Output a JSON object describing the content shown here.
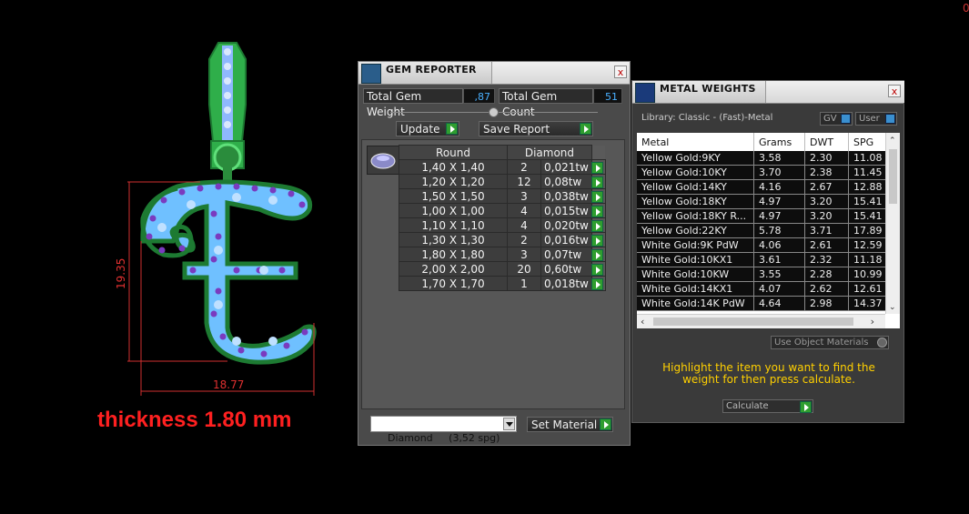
{
  "viewport": {
    "dimension_height": "19.35",
    "dimension_width": "18.77",
    "thickness_label": "thickness 1.80 mm",
    "corner_mark": "0"
  },
  "gem_reporter": {
    "title": "GEM REPORTER",
    "close": "x",
    "total_gem_weight_label": "Total Gem Weight",
    "total_gem_weight_value": ",87",
    "total_gem_count_label": "Total Gem Count",
    "total_gem_count_value": "51",
    "update_label": "Update",
    "save_report_label": "Save Report",
    "table_headers": [
      "Round",
      "Diamond"
    ],
    "rows": [
      {
        "size": "1,40 X 1,40",
        "count": "2",
        "weight": "0,021tw"
      },
      {
        "size": "1,20 X 1,20",
        "count": "12",
        "weight": "0,08tw"
      },
      {
        "size": "1,50 X 1,50",
        "count": "3",
        "weight": "0,038tw"
      },
      {
        "size": "1,00 X 1,00",
        "count": "4",
        "weight": "0,015tw"
      },
      {
        "size": "1,10 X 1,10",
        "count": "4",
        "weight": "0,020tw"
      },
      {
        "size": "1,30 X 1,30",
        "count": "2",
        "weight": "0,016tw"
      },
      {
        "size": "1,80 X 1,80",
        "count": "3",
        "weight": "0,07tw"
      },
      {
        "size": "2,00 X 2,00",
        "count": "20",
        "weight": "0,60tw"
      },
      {
        "size": "1,70 X 1,70",
        "count": "1",
        "weight": "0,018tw"
      }
    ],
    "material_select": "Diamond     (3,52 spg)",
    "set_material_label": "Set Material"
  },
  "metal_weights": {
    "title": "METAL WEIGHTS",
    "close": "x",
    "library_label": "Library: Classic - (Fast)-Metal",
    "gv_label": "GV",
    "user_label": "User",
    "columns": [
      "Metal",
      "Grams",
      "DWT",
      "SPG"
    ],
    "rows": [
      {
        "metal": "Yellow Gold:9KY",
        "grams": "3.58",
        "dwt": "2.30",
        "spg": "11.08"
      },
      {
        "metal": "Yellow Gold:10KY",
        "grams": "3.70",
        "dwt": "2.38",
        "spg": "11.45"
      },
      {
        "metal": "Yellow Gold:14KY",
        "grams": "4.16",
        "dwt": "2.67",
        "spg": "12.88"
      },
      {
        "metal": "Yellow Gold:18KY",
        "grams": "4.97",
        "dwt": "3.20",
        "spg": "15.41"
      },
      {
        "metal": "Yellow Gold:18KY R...",
        "grams": "4.97",
        "dwt": "3.20",
        "spg": "15.41"
      },
      {
        "metal": "Yellow Gold:22KY",
        "grams": "5.78",
        "dwt": "3.71",
        "spg": "17.89"
      },
      {
        "metal": "White Gold:9K PdW",
        "grams": "4.06",
        "dwt": "2.61",
        "spg": "12.59"
      },
      {
        "metal": "White Gold:10KX1",
        "grams": "3.61",
        "dwt": "2.32",
        "spg": "11.18"
      },
      {
        "metal": "White Gold:10KW",
        "grams": "3.55",
        "dwt": "2.28",
        "spg": "10.99"
      },
      {
        "metal": "White Gold:14KX1",
        "grams": "4.07",
        "dwt": "2.62",
        "spg": "12.61"
      },
      {
        "metal": "White Gold:14K PdW",
        "grams": "4.64",
        "dwt": "2.98",
        "spg": "14.37"
      }
    ],
    "use_object_materials": "Use Object Materials",
    "hint": "Highlight the item you want to find the weight for then press calculate.",
    "calculate_label": "Calculate"
  }
}
